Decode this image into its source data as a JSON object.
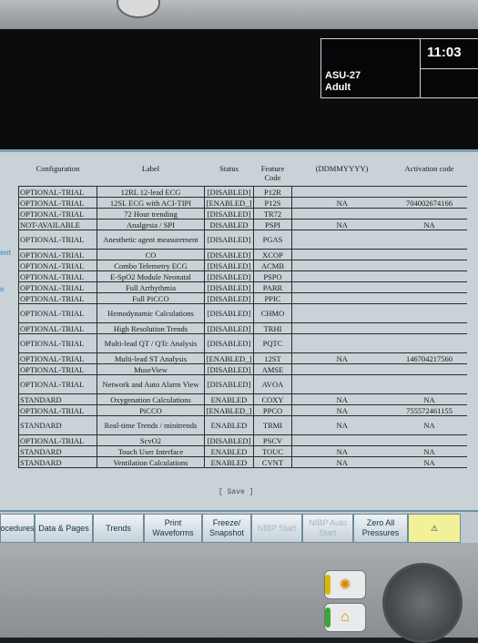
{
  "header": {
    "clock": "11:03",
    "patient_id": "ASU-27",
    "patient_type": "Adult"
  },
  "side_labels": [
    "ent",
    "e"
  ],
  "table": {
    "columns": [
      "Configuration",
      "Label",
      "Status",
      "Feature Code",
      "(DDMMYYYY)",
      "Activation code"
    ],
    "rows": [
      [
        "OPTIONAL-TRIAL",
        "12RL 12-lead ECG",
        "[DISABLED]",
        "P12R",
        "",
        ""
      ],
      [
        "OPTIONAL-TRIAL",
        "12SL ECG with ACI-TIPI",
        "[ENABLED_]",
        "P12S",
        "NA",
        "704002674166"
      ],
      [
        "OPTIONAL-TRIAL",
        "72 Hour trending",
        "[DISABLED]",
        "TR72",
        "",
        ""
      ],
      [
        "NOT-AVAILABLE",
        "Analgesia / SPI",
        "DISABLED",
        "PSPI",
        "NA",
        "NA"
      ],
      [
        "OPTIONAL-TRIAL",
        "Anesthetic agent measurement",
        "[DISABLED]",
        "PGAS",
        "",
        ""
      ],
      [
        "OPTIONAL-TRIAL",
        "CO",
        "[DISABLED]",
        "XCOP",
        "",
        ""
      ],
      [
        "OPTIONAL-TRIAL",
        "Combo Telemetry ECG",
        "[DISABLED]",
        "ACMB",
        "",
        ""
      ],
      [
        "OPTIONAL-TRIAL",
        "E-SpO2 Module Neonatal",
        "[DISABLED]",
        "PSPO",
        "",
        ""
      ],
      [
        "OPTIONAL-TRIAL",
        "Full Arrhythmia",
        "[DISABLED]",
        "PARR",
        "",
        ""
      ],
      [
        "OPTIONAL-TRIAL",
        "Full PiCCO",
        "[DISABLED]",
        "PPIC",
        "",
        ""
      ],
      [
        "OPTIONAL-TRIAL",
        "Hemodynamic Calculations",
        "[DISABLED]",
        "CHMO",
        "",
        ""
      ],
      [
        "OPTIONAL-TRIAL",
        "High Resolution Trends",
        "[DISABLED]",
        "TRHI",
        "",
        ""
      ],
      [
        "OPTIONAL-TRIAL",
        "Multi-lead QT / QTc Analysis",
        "[DISABLED]",
        "PQTC",
        "",
        ""
      ],
      [
        "OPTIONAL-TRIAL",
        "Multi-lead ST Analysis",
        "[ENABLED_]",
        "12ST",
        "NA",
        "146704217560"
      ],
      [
        "OPTIONAL-TRIAL",
        "MuseView",
        "[DISABLED]",
        "AMSE",
        "",
        ""
      ],
      [
        "OPTIONAL-TRIAL",
        "Network and Auto Alarm View",
        "[DISABLED]",
        "AVOA",
        "",
        ""
      ],
      [
        "STANDARD",
        "Oxygenation Calculations",
        "ENABLED",
        "COXY",
        "NA",
        "NA"
      ],
      [
        "OPTIONAL-TRIAL",
        "PiCCO",
        "[ENABLED_]",
        "PPCO",
        "NA",
        "755572461155"
      ],
      [
        "STANDARD",
        "Real-time Trends / minitrends",
        "ENABLED",
        "TRMI",
        "NA",
        "NA"
      ],
      [
        "OPTIONAL-TRIAL",
        "ScvO2",
        "[DISABLED]",
        "PSCV",
        "",
        ""
      ],
      [
        "STANDARD",
        "Touch User Interface",
        "ENABLED",
        "TOUC",
        "NA",
        "NA"
      ],
      [
        "STANDARD",
        "Ventilation Calculations",
        "ENABLED",
        "CVNT",
        "NA",
        "NA"
      ]
    ]
  },
  "save_label": "[ Save ]",
  "buttons": [
    {
      "label": "ocedures"
    },
    {
      "label": "Data & Pages"
    },
    {
      "label": "Trends"
    },
    {
      "label": "Print Waveforms"
    },
    {
      "label": "Freeze/ Snapshot"
    },
    {
      "label": "NIBP Start"
    },
    {
      "label": "NIBP Auto Start"
    },
    {
      "label": "Zero All Pressures"
    },
    {
      "label": "⚠"
    }
  ],
  "colors": {
    "accent": "#6f8fa3",
    "dialog_bg": "#c9d2d6",
    "alarm_yellow": "#f3f09a"
  }
}
